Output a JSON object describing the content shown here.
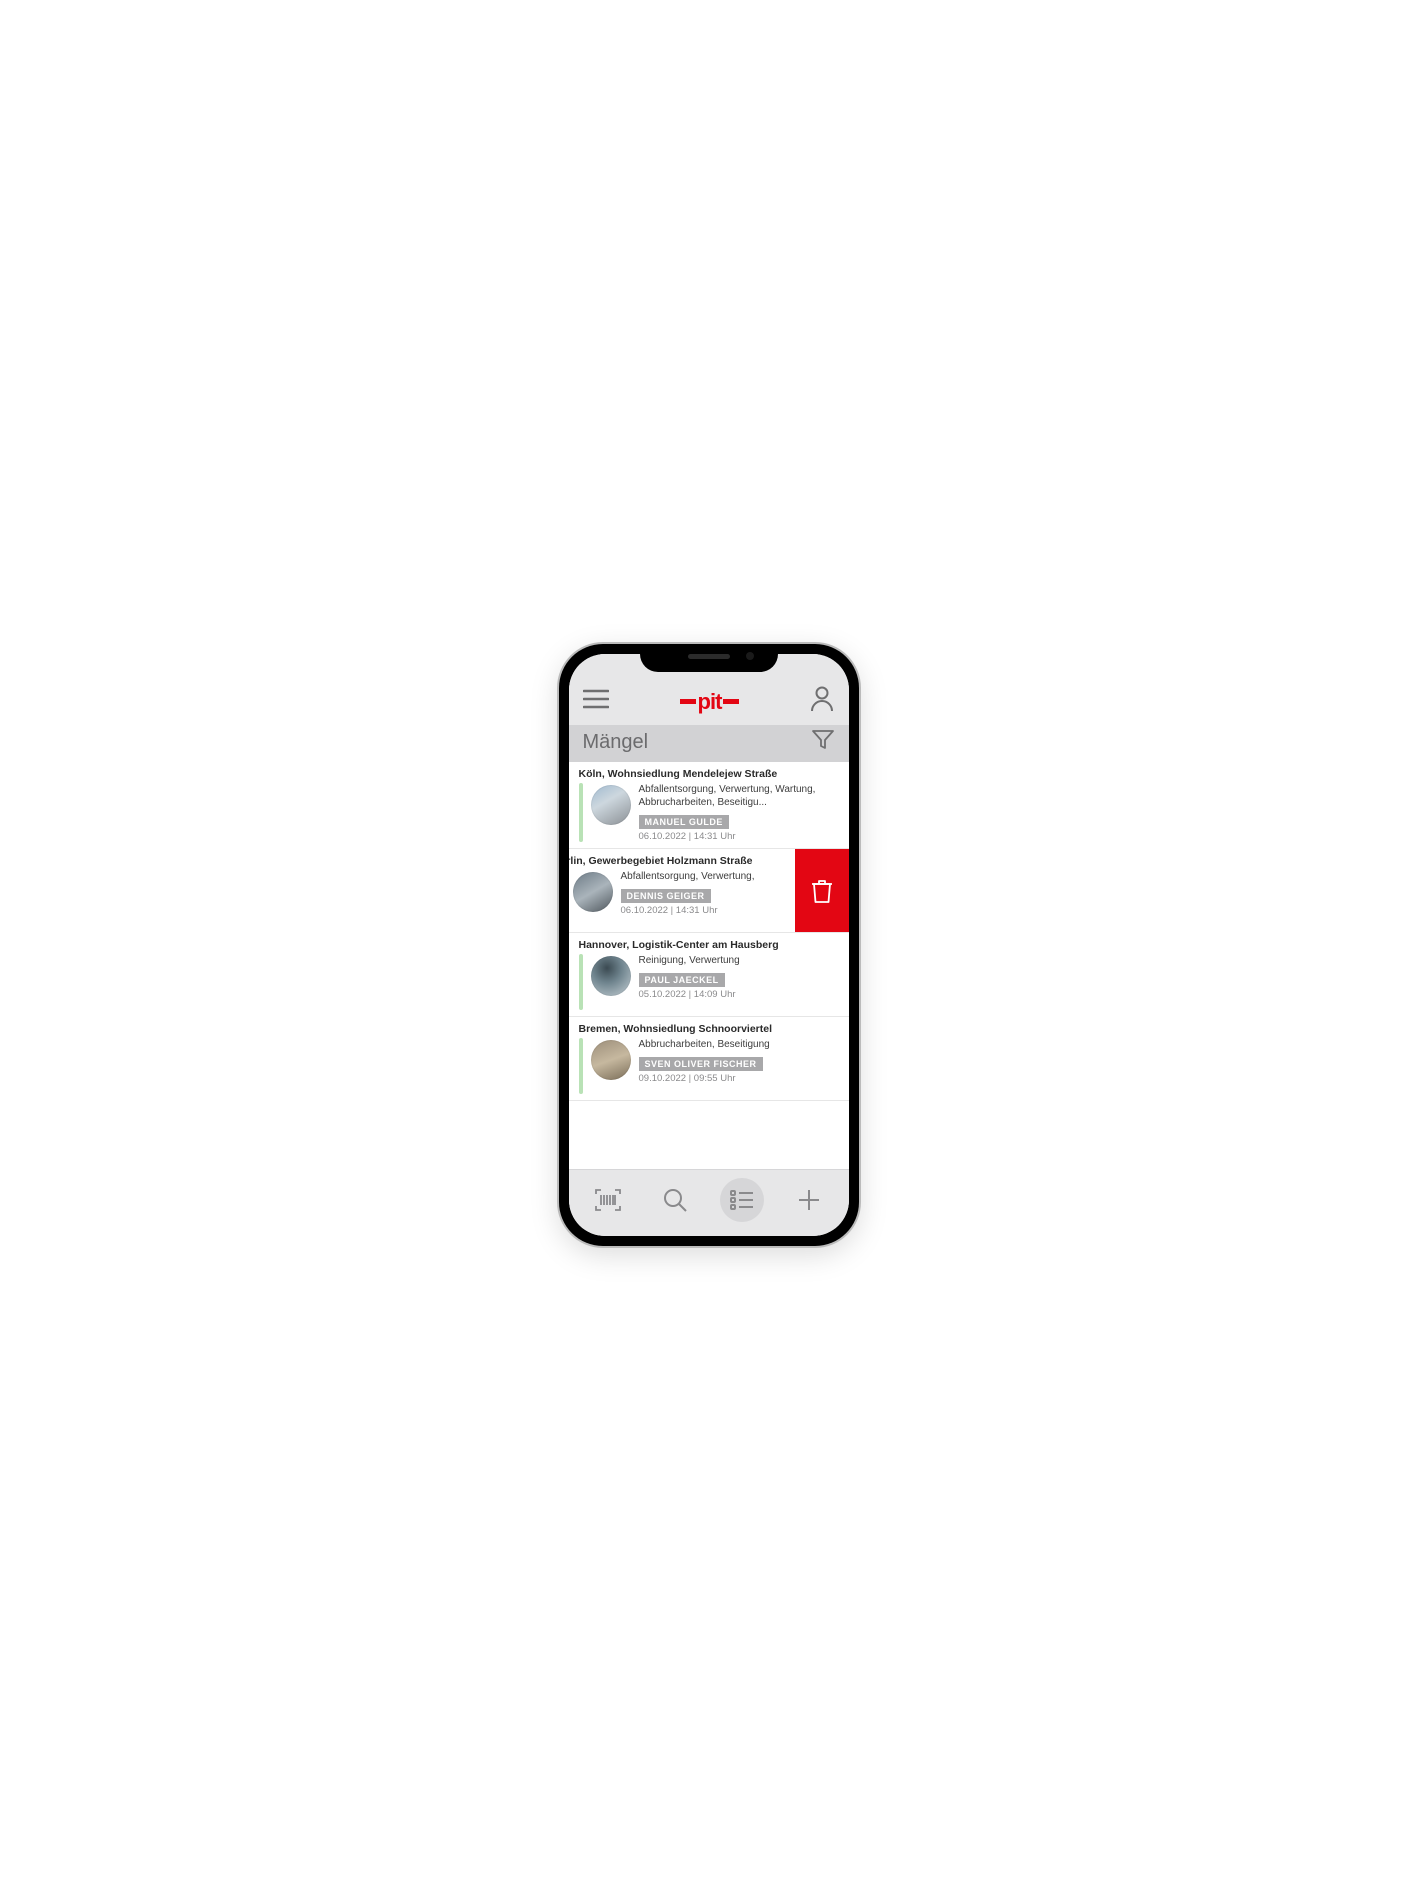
{
  "header": {
    "logo_text": "pit"
  },
  "page": {
    "title": "Mängel"
  },
  "items": [
    {
      "location": "Köln, Wohnsiedlung Mendelejew Straße",
      "description": "Abfallentsorgung, Verwertung, Wartung, Abbrucharbeiten, Beseitigu...",
      "user": "MANUEL GULDE",
      "datetime": "06.10.2022 | 14:31 Uhr"
    },
    {
      "location": "erlin, Gewerbegebiet Holzmann Straße",
      "description": "Abfallentsorgung, Verwertung,",
      "user": "DENNIS GEIGER",
      "datetime": "06.10.2022 | 14:31 Uhr"
    },
    {
      "location": "Hannover, Logistik-Center am Hausberg",
      "description": "Reinigung, Verwertung",
      "user": "PAUL JAECKEL",
      "datetime": "05.10.2022 | 14:09 Uhr"
    },
    {
      "location": "Bremen, Wohnsiedlung Schnoorviertel",
      "description": "Abbrucharbeiten, Beseitigung",
      "user": "SVEN OLIVER FISCHER",
      "datetime": "09.10.2022 | 09:55 Uhr"
    }
  ],
  "colors": {
    "brand": "#e30613",
    "status_green": "#b9e2b6"
  }
}
